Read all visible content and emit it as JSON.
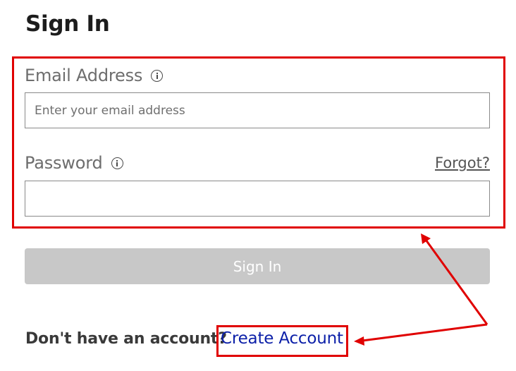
{
  "page": {
    "title": "Sign In"
  },
  "email": {
    "label": "Email Address",
    "placeholder": "Enter your email address",
    "value": ""
  },
  "password": {
    "label": "Password",
    "value": ""
  },
  "forgot_label": "Forgot?",
  "signin_button_label": "Sign In",
  "footer": {
    "prompt": "Don't have an account?",
    "create_link_label": "Create Account"
  },
  "colors": {
    "annotation": "#e00000",
    "link": "#0b1fa8",
    "disabled_button": "#c8c8c8"
  },
  "icons": {
    "email_info": "info-icon",
    "password_info": "info-icon"
  }
}
